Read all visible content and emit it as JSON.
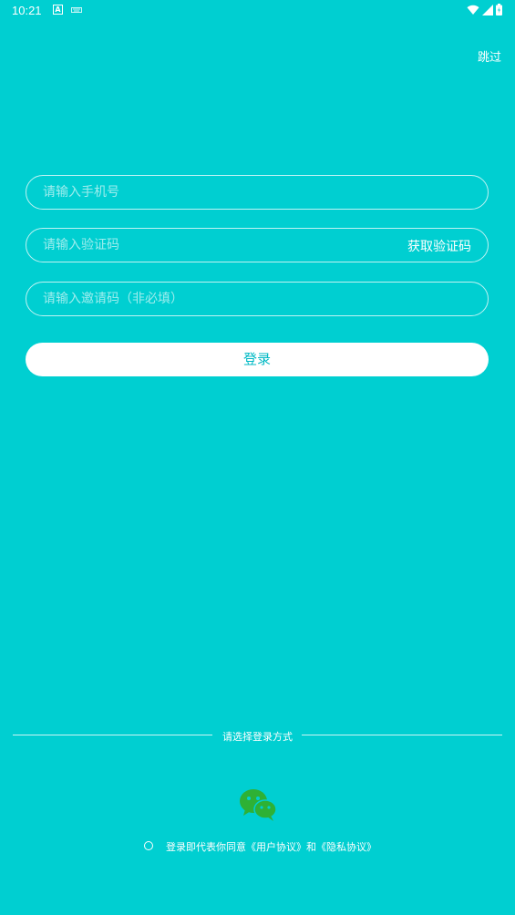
{
  "status_bar": {
    "time": "10:21",
    "icon_a_letter": "A"
  },
  "header": {
    "skip_label": "跳过"
  },
  "form": {
    "phone_placeholder": "请输入手机号",
    "code_placeholder": "请输入验证码",
    "get_code_label": "获取验证码",
    "invite_placeholder": "请输入邀请码（非必填）",
    "login_label": "登录"
  },
  "other_login": {
    "divider_text": "请选择登录方式",
    "wechat_icon": "wechat-icon"
  },
  "agreement": {
    "prefix": "登录即代表你同意",
    "user_agreement": "《用户协议》",
    "conjunction": "和",
    "privacy_agreement": "《隐私协议》"
  },
  "colors": {
    "background": "#00CFD1",
    "button_text": "#00B9C4",
    "wechat": "#2EB135"
  }
}
